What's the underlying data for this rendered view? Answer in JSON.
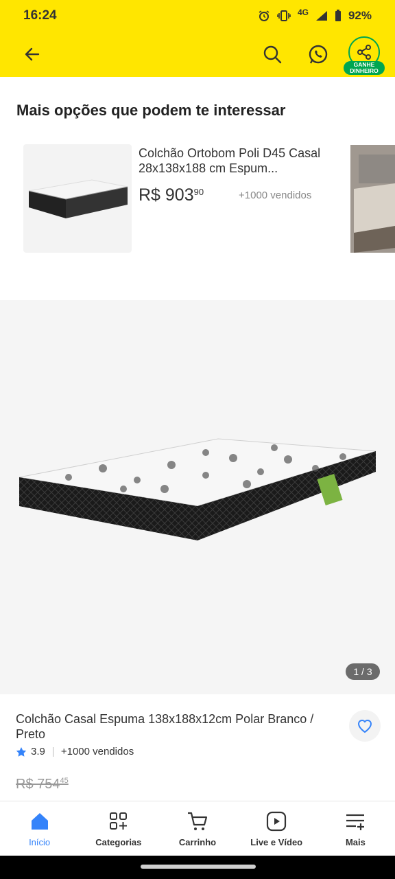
{
  "status": {
    "time": "16:24",
    "network": "4G",
    "battery": "92%"
  },
  "header": {
    "ganhe_line1": "GANHE",
    "ganhe_line2": "DINHEIRO"
  },
  "recommendations": {
    "title": "Mais opções que podem te interessar",
    "item": {
      "title": "Colchão Ortobom Poli D45 Casal 28x138x188 cm Espum...",
      "price_int": "R$ 903",
      "price_cents": "90",
      "sold": "+1000 vendidos"
    }
  },
  "gallery": {
    "pager": "1 / 3"
  },
  "product": {
    "title": "Colchão Casal Espuma 138x188x12cm Polar Branco / Preto",
    "rating": "3.9",
    "sold": "+1000 vendidos",
    "old_price_int": "R$ 754",
    "old_price_cents": "45"
  },
  "tabs": [
    {
      "label": "Início",
      "icon": "home-icon",
      "active": true
    },
    {
      "label": "Categorias",
      "icon": "categories-icon"
    },
    {
      "label": "Carrinho",
      "icon": "cart-icon"
    },
    {
      "label": "Live e Vídeo",
      "icon": "video-icon"
    },
    {
      "label": "Mais",
      "icon": "menu-plus-icon"
    }
  ],
  "colors": {
    "header_yellow": "#ffe600",
    "accent_blue": "#3483fa",
    "share_green": "#00a650"
  }
}
